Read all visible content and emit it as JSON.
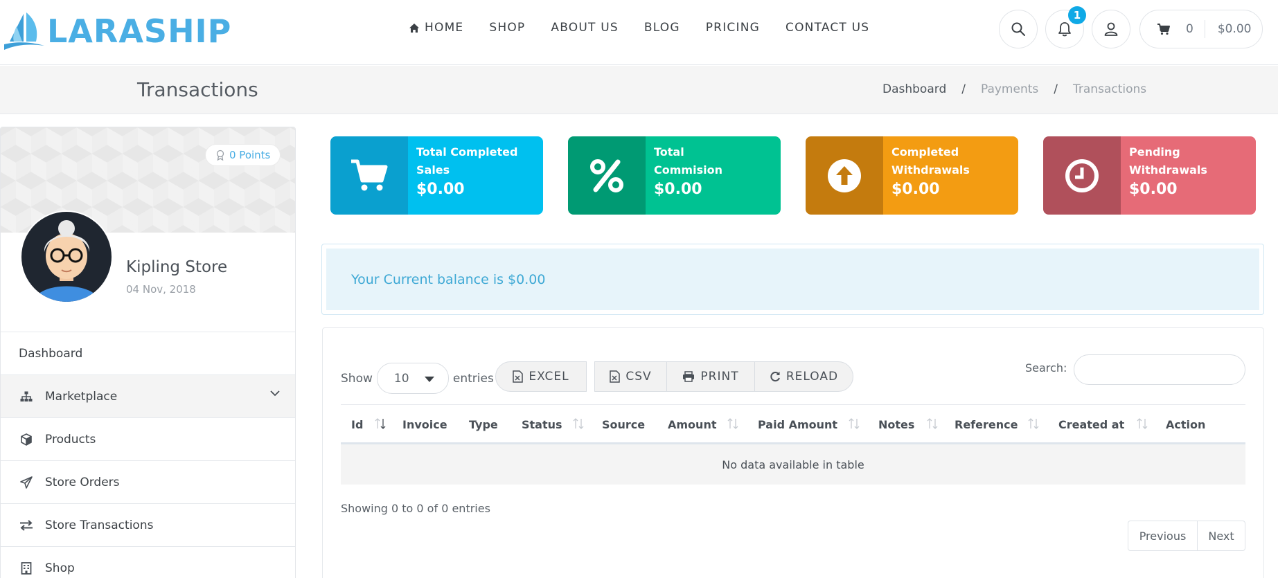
{
  "brand": {
    "name": "LARASHIP"
  },
  "nav": {
    "items": [
      {
        "label": "HOME",
        "icon": "home-icon"
      },
      {
        "label": "SHOP"
      },
      {
        "label": "ABOUT US"
      },
      {
        "label": "BLOG"
      },
      {
        "label": "PRICING"
      },
      {
        "label": "CONTACT US"
      }
    ]
  },
  "header": {
    "notifications_count": "1",
    "cart_count": "0",
    "cart_total": "$0.00"
  },
  "page": {
    "title": "Transactions",
    "breadcrumb": [
      "Dashboard",
      "Payments",
      "Transactions"
    ]
  },
  "profile": {
    "points": "0 Points",
    "store_name": "Kipling Store",
    "date": "04 Nov, 2018"
  },
  "sidebar": {
    "items": [
      {
        "label": "Dashboard",
        "icon": ""
      },
      {
        "label": "Marketplace",
        "icon": "sitemap-icon"
      },
      {
        "label": "Products",
        "icon": "cube-icon"
      },
      {
        "label": "Store Orders",
        "icon": "paper-plane-icon"
      },
      {
        "label": "Store Transactions",
        "icon": "exchange-icon"
      },
      {
        "label": "Shop",
        "icon": "building-icon"
      }
    ]
  },
  "cards": [
    {
      "label_line1": "Total Completed",
      "label_line2": "Sales",
      "value": "$0.00",
      "icon": "cart-icon",
      "color_dark": "#0aa0cf",
      "color": "#00c0ef"
    },
    {
      "label_line1": "Total",
      "label_line2": "Commision",
      "value": "$0.00",
      "icon": "percent-icon",
      "color_dark": "#009a73",
      "color": "#00c292"
    },
    {
      "label_line1": "Completed",
      "label_line2": "Withdrawals",
      "value": "$0.00",
      "icon": "arrow-up-circle-icon",
      "color_dark": "#c47b0e",
      "color": "#f39c12"
    },
    {
      "label_line1": "Pending",
      "label_line2": "Withdrawals",
      "value": "$0.00",
      "icon": "clock-icon",
      "color_dark": "#b0505b",
      "color": "#e66b77"
    }
  ],
  "alert": {
    "text": "Your Current balance is $0.00"
  },
  "table": {
    "show_label": "Show",
    "entries_label": "entries",
    "page_length": "10",
    "buttons": [
      "EXCEL",
      "CSV",
      "PRINT",
      "RELOAD"
    ],
    "search_label": "Search:",
    "search_value": "",
    "columns": [
      "Id",
      "Invoice",
      "Type",
      "Status",
      "Source",
      "Amount",
      "Paid Amount",
      "Notes",
      "Reference",
      "Created at",
      "Action"
    ],
    "empty_text": "No data available in table",
    "info": "Showing 0 to 0 of 0 entries",
    "prev_label": "Previous",
    "next_label": "Next"
  }
}
